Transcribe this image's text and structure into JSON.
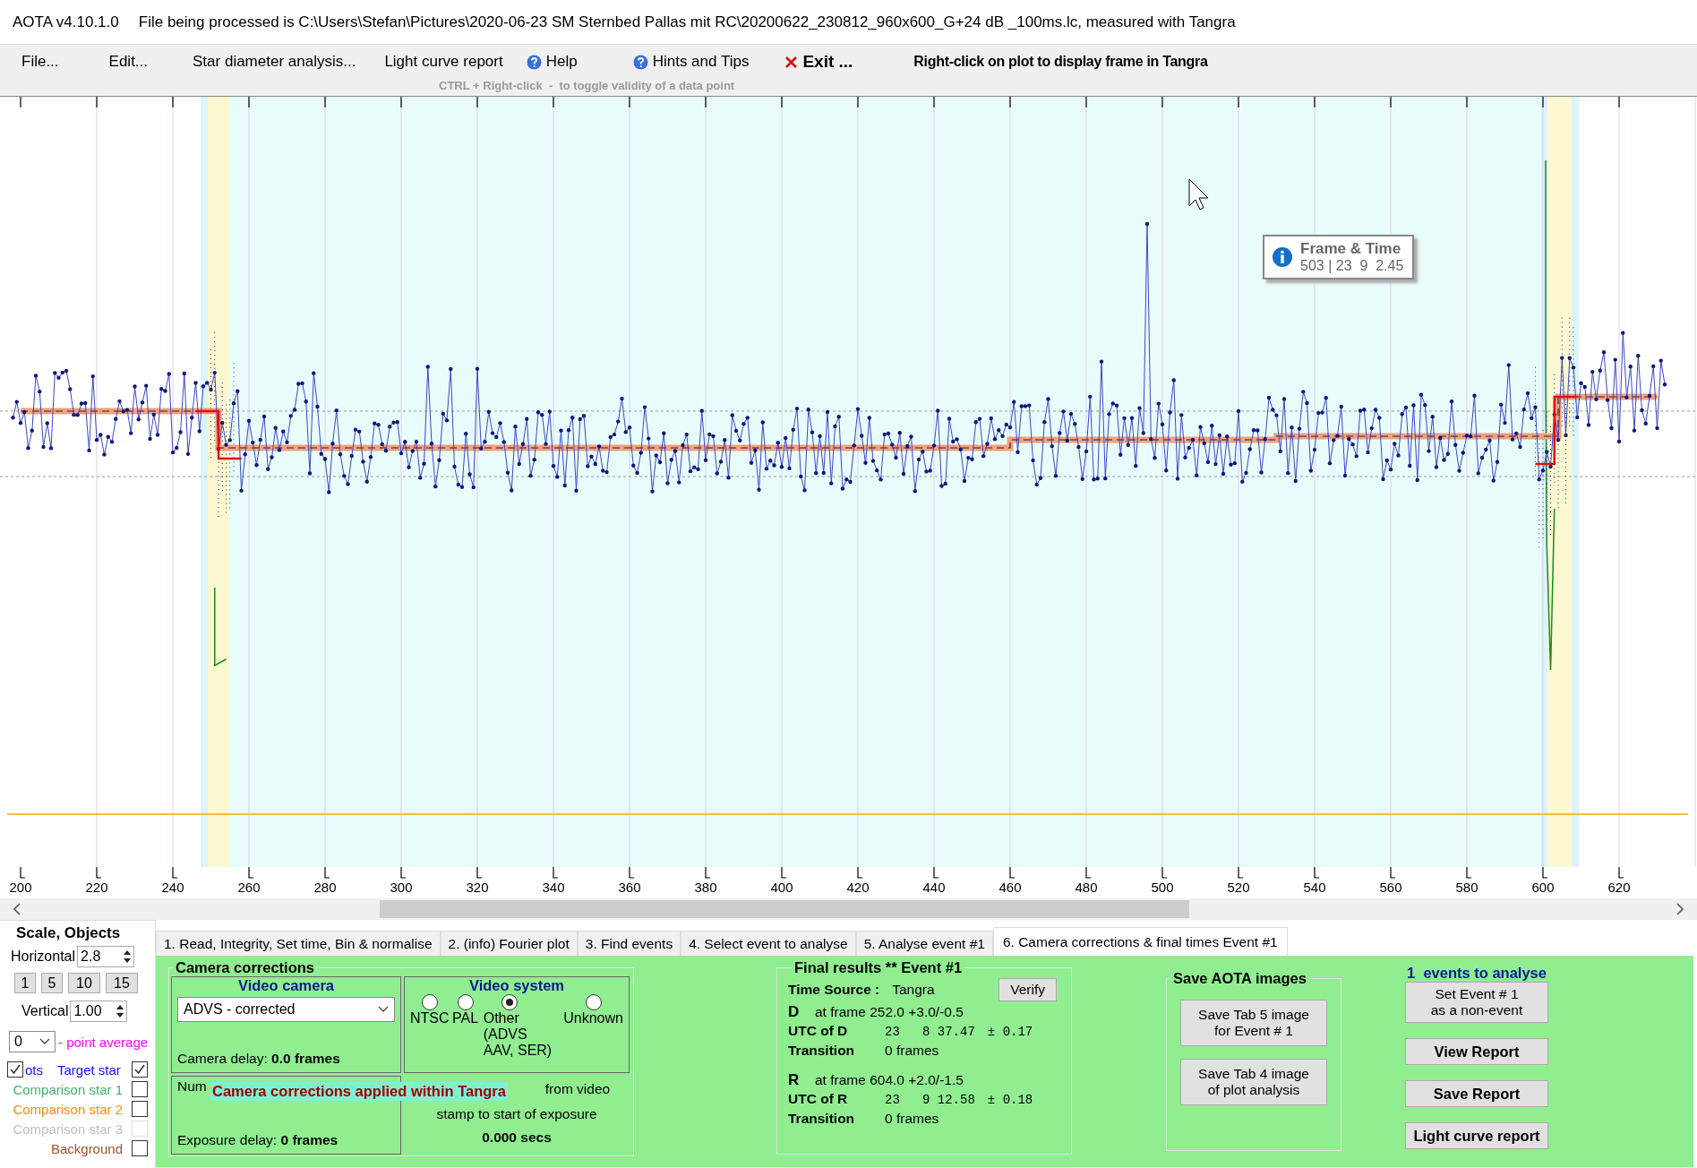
{
  "window": {
    "app": "AOTA v4.10.1.0",
    "file_info": "File being processed is C:\\Users\\Stefan\\Pictures\\2020-06-23 SM Sternbed Pallas mit RC\\20200622_230812_960x600_G+24 dB  _100ms.lc, measured with Tangra"
  },
  "menu": [
    {
      "label": "File...",
      "kind": "text"
    },
    {
      "label": "Edit...",
      "kind": "text"
    },
    {
      "label": "Star diameter analysis...",
      "kind": "text"
    },
    {
      "label": "Light curve report",
      "kind": "text"
    },
    {
      "label": "Help",
      "kind": "help"
    },
    {
      "label": "Hints and Tips",
      "kind": "help"
    },
    {
      "label": "Exit ...",
      "kind": "exit"
    }
  ],
  "plot_hint": "Right-click on plot to display frame in Tangra",
  "ctrl_hint": "CTRL + Right-click  -  to toggle validity of a data point",
  "plot": {
    "x_ticks": [
      "200",
      "220",
      "240",
      "260",
      "280",
      "300",
      "320",
      "340",
      "360",
      "380",
      "400",
      "420",
      "440",
      "460",
      "480",
      "500",
      "520",
      "540",
      "560",
      "580",
      "600",
      "620"
    ],
    "tooltip": {
      "title": "Frame & Time",
      "value": "503 | 23  9  2.45"
    }
  },
  "scale": {
    "title": "Scale,  Objects",
    "horizontal_label": "Horizontal",
    "horizontal": "2.8",
    "presets": [
      "1",
      "5",
      "10",
      "15"
    ],
    "vertical_label": "Vertical",
    "vertical": "1.00",
    "average": "0",
    "average_label": "- point average",
    "dots": {
      "label": "ots",
      "checked": true
    },
    "objects": [
      {
        "label": "Target star",
        "color": "#1010ff",
        "checked": true,
        "disabled": false
      },
      {
        "label": "Comparison star 1",
        "color": "#3cb371",
        "checked": false,
        "disabled": false
      },
      {
        "label": "Comparison star 2",
        "color": "#ff8c00",
        "checked": false,
        "disabled": false
      },
      {
        "label": "Comparison star 3",
        "color": "#c0c0c0",
        "checked": false,
        "disabled": true
      },
      {
        "label": "Background",
        "color": "#a0522d",
        "checked": false,
        "disabled": false
      }
    ]
  },
  "tabs": [
    {
      "label": "1.  Read, Integrity, Set time, Bin & normalise",
      "selected": false
    },
    {
      "label": "2. (info)  Fourier plot",
      "selected": false
    },
    {
      "label": "3. Find events",
      "selected": false
    },
    {
      "label": "4. Select event to analyse",
      "selected": false
    },
    {
      "label": "5. Analyse event #1",
      "selected": false
    },
    {
      "label": "6. Camera corrections & final times Event #1",
      "selected": true
    }
  ],
  "camera_corrections": {
    "title": "Camera corrections",
    "video_camera": {
      "title": "Video camera",
      "selection": "ADVS - corrected",
      "delay_label": "Camera delay:",
      "delay_value": "0.0 frames"
    },
    "video_system": {
      "title": "Video system",
      "options": [
        {
          "label": "NTSC",
          "selected": false
        },
        {
          "label": "PAL",
          "selected": false
        },
        {
          "label": "Other (ADVS AAV, SER)",
          "selected": true
        },
        {
          "label": "Unknown",
          "selected": false
        }
      ]
    },
    "integration": {
      "label_1": "Num",
      "delay_label": "Exposure delay:",
      "delay_value": "0 frames"
    },
    "offset": {
      "text_1": "from video",
      "text_2": "stamp to start of exposure",
      "value": "0.000 secs"
    },
    "notice": "Camera corrections applied within Tangra"
  },
  "final_results": {
    "title": "Final results  **  Event #1",
    "time_source_label": "Time Source :",
    "time_source": "Tangra",
    "verify": "Verify",
    "events": [
      {
        "letter": "D",
        "frame": "at frame 252.0  +3.0/-0.5",
        "utc_label": "UTC of D",
        "utc": "23   8 37.47",
        "err": "± 0.17",
        "transition_label": "Transition",
        "transition": "0 frames"
      },
      {
        "letter": "R",
        "frame": "at frame 604.0  +2.0/-1.5",
        "utc_label": "UTC of R",
        "utc": "23   9 12.58",
        "err": "± 0.18",
        "transition_label": "Transition",
        "transition": "0 frames"
      }
    ]
  },
  "save_images": {
    "title": "Save AOTA images",
    "buttons": [
      "Save Tab 5 image\nfor Event # 1",
      "Save Tab 4 image\nof plot analysis"
    ]
  },
  "events_count": "1  events to analyse",
  "actions": [
    {
      "label": "Set Event # 1\nas a non-event",
      "kind": "normal"
    },
    {
      "label": "View Report",
      "kind": "bold"
    },
    {
      "label": "Save Report",
      "kind": "bold"
    },
    {
      "label": "Light curve report",
      "kind": "bold"
    }
  ]
}
